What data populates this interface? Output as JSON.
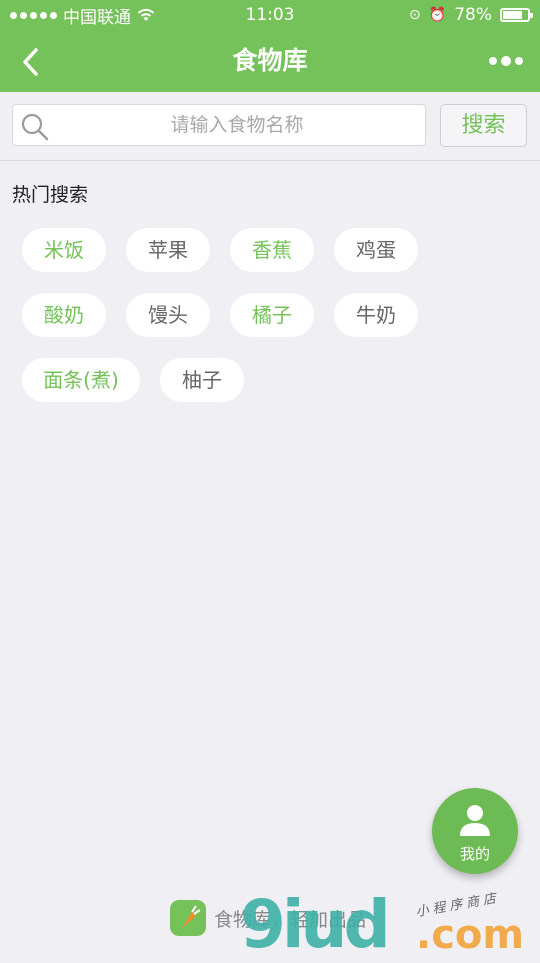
{
  "status_bar": {
    "carrier": "中国联通",
    "time": "11:03",
    "battery_text": "78%",
    "battery_level": 0.78
  },
  "navbar": {
    "title": "食物库",
    "back_icon": "chevron-left-icon",
    "more_icon": "more-dots-icon"
  },
  "search": {
    "placeholder": "请输入食物名称",
    "button_label": "搜索"
  },
  "hot": {
    "title": "热门搜索",
    "tags": [
      {
        "label": "米饭",
        "color": "#75c15a"
      },
      {
        "label": "苹果",
        "color": "#666666"
      },
      {
        "label": "香蕉",
        "color": "#75c15a"
      },
      {
        "label": "鸡蛋",
        "color": "#666666"
      },
      {
        "label": "酸奶",
        "color": "#75c15a"
      },
      {
        "label": "馒头",
        "color": "#666666"
      },
      {
        "label": "橘子",
        "color": "#75c15a"
      },
      {
        "label": "牛奶",
        "color": "#666666"
      },
      {
        "label": "面条(煮)",
        "color": "#75c15a"
      },
      {
        "label": "柚子",
        "color": "#666666"
      }
    ]
  },
  "fab": {
    "label": "我的",
    "icon": "user-icon"
  },
  "footer": {
    "text": "食物库，轻加出品"
  },
  "watermark": {
    "big": "9iud",
    "com": ".com",
    "small": "小程序商店"
  },
  "colors": {
    "accent": "#75c15a",
    "background": "#efeff4"
  }
}
